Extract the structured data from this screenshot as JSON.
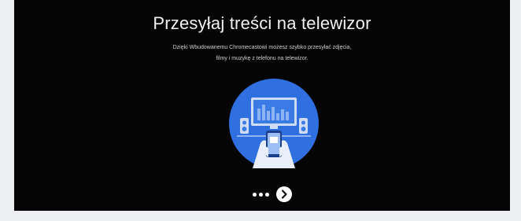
{
  "onboarding": {
    "title": "Przesyłaj treści na telewizor",
    "description_line1": "Dzięki Wbudowanemu Chromecastowi możesz szybko przesyłać zdjęcia,",
    "description_line2": "filmy i muzykę z telefonu na telewizor.",
    "pager": {
      "total_dots": 3,
      "next_icon": "chevron-right-icon"
    }
  },
  "colors": {
    "screen_background": "#050505",
    "page_background": "#eceef1",
    "illustration_circle": "#2f6fe0",
    "illustration_accent": "#8fb4f5"
  }
}
